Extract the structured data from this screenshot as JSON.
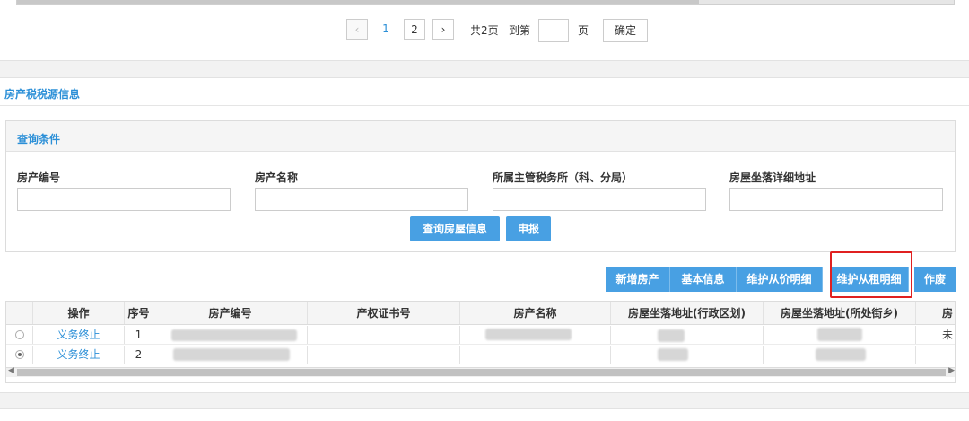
{
  "pagination": {
    "prev": "‹",
    "page1": "1",
    "page2": "2",
    "next": "›",
    "total": "共2页",
    "goto_label": "到第",
    "goto_value": "",
    "page_suffix": "页",
    "confirm": "确定"
  },
  "section": {
    "title": "房产税税源信息"
  },
  "query": {
    "title": "查询条件",
    "fields": [
      {
        "label": "房产编号",
        "value": ""
      },
      {
        "label": "房产名称",
        "value": ""
      },
      {
        "label": "所属主管税务所（科、分局）",
        "value": ""
      },
      {
        "label": "房屋坐落详细地址",
        "value": ""
      }
    ],
    "search_button": "查询房屋信息",
    "declare_button": "申报"
  },
  "toolbar": {
    "buttons": [
      "新增房产",
      "基本信息",
      "维护从价明细",
      "维护从租明细",
      "作废"
    ]
  },
  "table": {
    "headers": [
      "操作",
      "序号",
      "房产编号",
      "产权证书号",
      "房产名称",
      "房屋坐落地址(行政区划)",
      "房屋坐落地址(所处街乡)",
      "房"
    ],
    "rows": [
      {
        "selected": false,
        "action": "义务终止",
        "index": "1",
        "last_col": "未"
      },
      {
        "selected": true,
        "action": "义务终止",
        "index": "2",
        "last_col": ""
      }
    ]
  },
  "colors": {
    "accent": "#2b8fd7",
    "button": "#48a0e3",
    "highlight": "#e02020"
  }
}
